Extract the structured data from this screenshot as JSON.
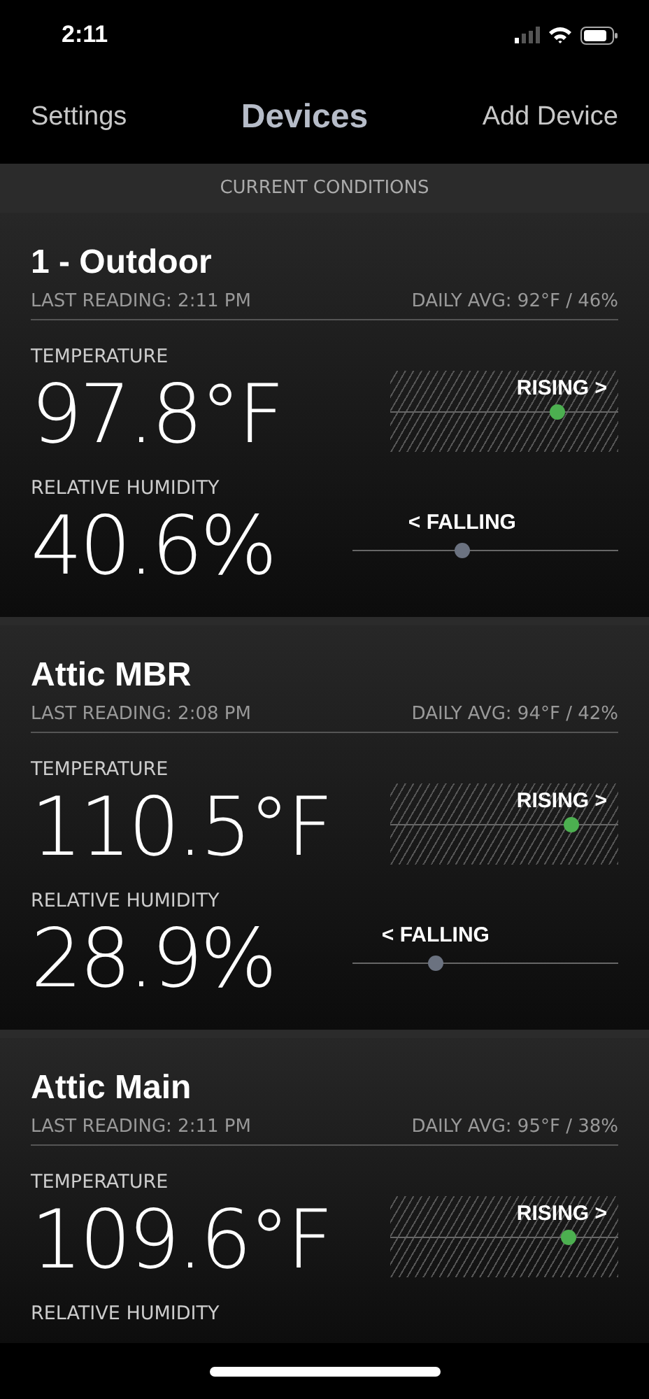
{
  "status_bar": {
    "time": "2:11"
  },
  "nav": {
    "left": "Settings",
    "title": "Devices",
    "right": "Add Device"
  },
  "section_header": "CURRENT CONDITIONS",
  "devices": [
    {
      "name": "1 - Outdoor",
      "last_reading": "LAST READING: 2:11 PM",
      "daily_avg": "DAILY AVG: 92°F / 46%",
      "metrics": [
        {
          "label": "TEMPERATURE",
          "value": "97.8°F",
          "trend": {
            "kind": "rising",
            "text": "RISING >",
            "level": 0.73,
            "color": "#4caf50"
          }
        },
        {
          "label": "RELATIVE HUMIDITY",
          "value": "40.6%",
          "trend": {
            "kind": "falling",
            "text": "< FALLING",
            "level": 0.41,
            "color": "#6b7280"
          }
        }
      ]
    },
    {
      "name": "Attic MBR",
      "last_reading": "LAST READING: 2:08 PM",
      "daily_avg": "DAILY AVG: 94°F / 42%",
      "metrics": [
        {
          "label": "TEMPERATURE",
          "value": "110.5°F",
          "trend": {
            "kind": "rising",
            "text": "RISING >",
            "level": 0.79,
            "color": "#4caf50"
          }
        },
        {
          "label": "RELATIVE HUMIDITY",
          "value": "28.9%",
          "trend": {
            "kind": "falling",
            "text": "< FALLING",
            "level": 0.31,
            "color": "#6b7280"
          }
        }
      ]
    },
    {
      "name": "Attic Main",
      "last_reading": "LAST READING: 2:11 PM",
      "daily_avg": "DAILY AVG: 95°F / 38%",
      "metrics": [
        {
          "label": "TEMPERATURE",
          "value": "109.6°F",
          "trend": {
            "kind": "rising",
            "text": "RISING >",
            "level": 0.78,
            "color": "#4caf50"
          }
        },
        {
          "label": "RELATIVE HUMIDITY"
        }
      ]
    }
  ]
}
